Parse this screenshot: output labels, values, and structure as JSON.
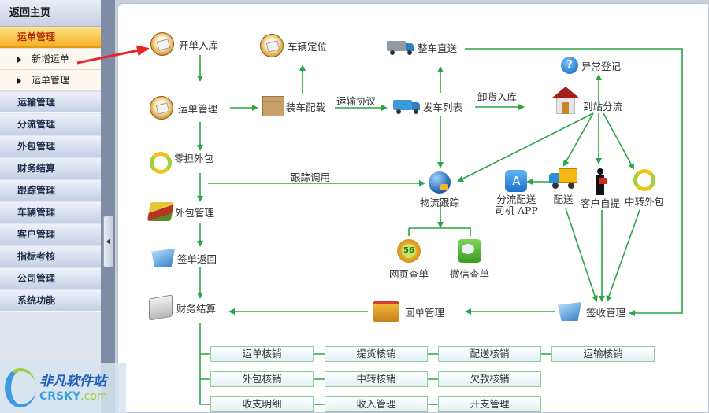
{
  "sidebar": {
    "home": "返回主页",
    "items": [
      {
        "label": "运单管理",
        "type": "group",
        "active": true
      },
      {
        "label": "新增运单",
        "type": "sub"
      },
      {
        "label": "运单管理",
        "type": "sub"
      },
      {
        "label": "运输管理",
        "type": "group"
      },
      {
        "label": "分流管理",
        "type": "group"
      },
      {
        "label": "外包管理",
        "type": "group"
      },
      {
        "label": "财务结算",
        "type": "group"
      },
      {
        "label": "跟踪管理",
        "type": "group"
      },
      {
        "label": "车辆管理",
        "type": "group"
      },
      {
        "label": "客户管理",
        "type": "group"
      },
      {
        "label": "指标考核",
        "type": "group"
      },
      {
        "label": "公司管理",
        "type": "group"
      },
      {
        "label": "系统功能",
        "type": "group"
      }
    ]
  },
  "flow": {
    "nodes": {
      "kaidan": "开单入库",
      "cheliang_dingwei": "车辆定位",
      "zhengche_zhisong": "整车直送",
      "yichang_dengji": "异常登记",
      "yundan_guanli": "运单管理",
      "zhuangche_peizai": "装车配载",
      "fache_liebiao": "发车列表",
      "daozhan_fenliu": "到站分流",
      "lingdan_waibao": "零担外包",
      "wuliu_genzong": "物流跟踪",
      "fenliu_peisong_app_1": "分流配送",
      "fenliu_peisong_app_2": "司机 APP",
      "peisong": "配送",
      "kehu_ziti": "客户自提",
      "zhongzhuan_waibao": "中转外包",
      "waibao_guanli": "外包管理",
      "qiandan_fanhui": "签单返回",
      "wangye_chadan": "网页查单",
      "weixin_chadan": "微信查单",
      "caiwu_jiesuan": "财务结算",
      "huidan_guanli": "回单管理",
      "qianshou_guanli": "签收管理"
    },
    "edge_labels": {
      "yunshu_xieyi": "运输协议",
      "xiehuo_ruku": "卸货入库",
      "genzong_diaoyong": "跟踪调用"
    },
    "finance_boxes": [
      [
        "运单核销",
        "提货核销",
        "配送核销",
        "运输核销"
      ],
      [
        "外包核销",
        "中转核销",
        "欠款核销"
      ],
      [
        "收支明细",
        "收入管理",
        "开支管理"
      ]
    ],
    "icons": {
      "mag56_text": "56",
      "question_text": "?",
      "app_text": "A"
    },
    "line_color": "#2aa446",
    "annotation_arrow_color": "#e8262a"
  },
  "watermark": {
    "title": "非凡软件站",
    "brand": "CRSKY",
    "suffix": ".com"
  }
}
